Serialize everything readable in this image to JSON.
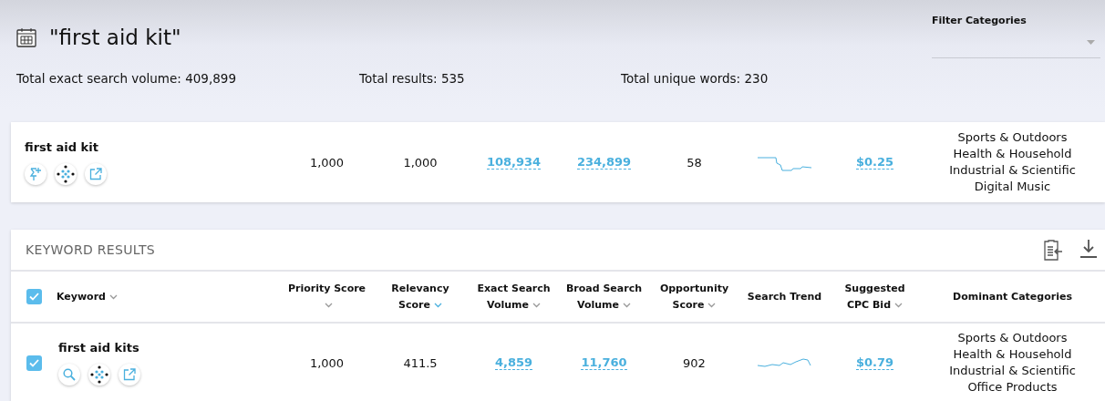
{
  "header": {
    "title": "\"first aid kit\"",
    "stats": [
      "Total exact search volume: 409,899",
      "Total results: 535",
      "Total unique words: 230"
    ]
  },
  "filter": {
    "label": "Filter Categories"
  },
  "summary": {
    "cells": [
      {
        "kind": "keyword",
        "value": "first aid kit"
      },
      {
        "kind": "text",
        "value": "1,000"
      },
      {
        "kind": "text",
        "value": "1,000"
      },
      {
        "kind": "link",
        "value": "108,934"
      },
      {
        "kind": "link",
        "value": "234,899"
      },
      {
        "kind": "text",
        "value": "58"
      },
      {
        "kind": "trend"
      },
      {
        "kind": "link",
        "value": "$0.25"
      },
      {
        "kind": "categories",
        "values": [
          "Sports & Outdoors",
          "Health & Household",
          "Industrial & Scientific",
          "Digital Music"
        ]
      }
    ]
  },
  "results": {
    "title": "KEYWORD RESULTS",
    "select_all_checked": true,
    "columns": [
      {
        "label": "Keyword",
        "kind": "sortable",
        "sorted": false
      },
      {
        "label": "Priority Score",
        "kind": "sortable",
        "sorted": false
      },
      {
        "label": "Relevancy Score",
        "kind": "sortable",
        "sorted": true
      },
      {
        "label": "Exact Search Volume",
        "kind": "sortable",
        "sorted": false
      },
      {
        "label": "Broad Search Volume",
        "kind": "sortable",
        "sorted": false
      },
      {
        "label": "Opportunity Score",
        "kind": "sortable",
        "sorted": false
      },
      {
        "label": "Search Trend",
        "kind": "plain"
      },
      {
        "label": "Suggested CPC Bid",
        "kind": "sortable",
        "sorted": false
      },
      {
        "label": "Dominant Categories",
        "kind": "plain"
      }
    ],
    "rows": [
      {
        "checked": true,
        "cells": [
          {
            "kind": "keyword",
            "value": "first aid kits"
          },
          {
            "kind": "text",
            "value": "1,000"
          },
          {
            "kind": "text",
            "value": "411.5"
          },
          {
            "kind": "link",
            "value": "4,859"
          },
          {
            "kind": "link",
            "value": "11,760"
          },
          {
            "kind": "text",
            "value": "902"
          },
          {
            "kind": "trend"
          },
          {
            "kind": "link",
            "value": "$0.79"
          },
          {
            "kind": "categories",
            "values": [
              "Sports & Outdoors",
              "Health & Household",
              "Industrial & Scientific",
              "Office Products"
            ]
          }
        ]
      }
    ]
  }
}
